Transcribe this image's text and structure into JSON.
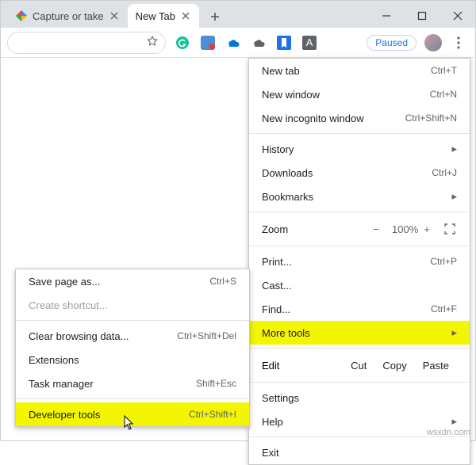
{
  "tabs": {
    "inactive": {
      "title": "Capture or take"
    },
    "active": {
      "title": "New Tab"
    }
  },
  "paused_label": "Paused",
  "watermark": "wsxdn.com",
  "menu": {
    "new_tab": {
      "label": "New tab",
      "shortcut": "Ctrl+T"
    },
    "new_window": {
      "label": "New window",
      "shortcut": "Ctrl+N"
    },
    "incognito": {
      "label": "New incognito window",
      "shortcut": "Ctrl+Shift+N"
    },
    "history": {
      "label": "History"
    },
    "downloads": {
      "label": "Downloads",
      "shortcut": "Ctrl+J"
    },
    "bookmarks": {
      "label": "Bookmarks"
    },
    "zoom": {
      "label": "Zoom",
      "minus": "−",
      "value": "100%",
      "plus": "+"
    },
    "print": {
      "label": "Print...",
      "shortcut": "Ctrl+P"
    },
    "cast": {
      "label": "Cast..."
    },
    "find": {
      "label": "Find...",
      "shortcut": "Ctrl+F"
    },
    "more_tools": {
      "label": "More tools"
    },
    "edit": {
      "label": "Edit",
      "cut": "Cut",
      "copy": "Copy",
      "paste": "Paste"
    },
    "settings": {
      "label": "Settings"
    },
    "help": {
      "label": "Help"
    },
    "exit": {
      "label": "Exit"
    }
  },
  "submenu": {
    "save_page": {
      "label": "Save page as...",
      "shortcut": "Ctrl+S"
    },
    "create_shortcut": {
      "label": "Create shortcut..."
    },
    "clear_data": {
      "label": "Clear browsing data...",
      "shortcut": "Ctrl+Shift+Del"
    },
    "extensions": {
      "label": "Extensions"
    },
    "task_manager": {
      "label": "Task manager",
      "shortcut": "Shift+Esc"
    },
    "devtools": {
      "label": "Developer tools",
      "shortcut": "Ctrl+Shift+I"
    }
  }
}
